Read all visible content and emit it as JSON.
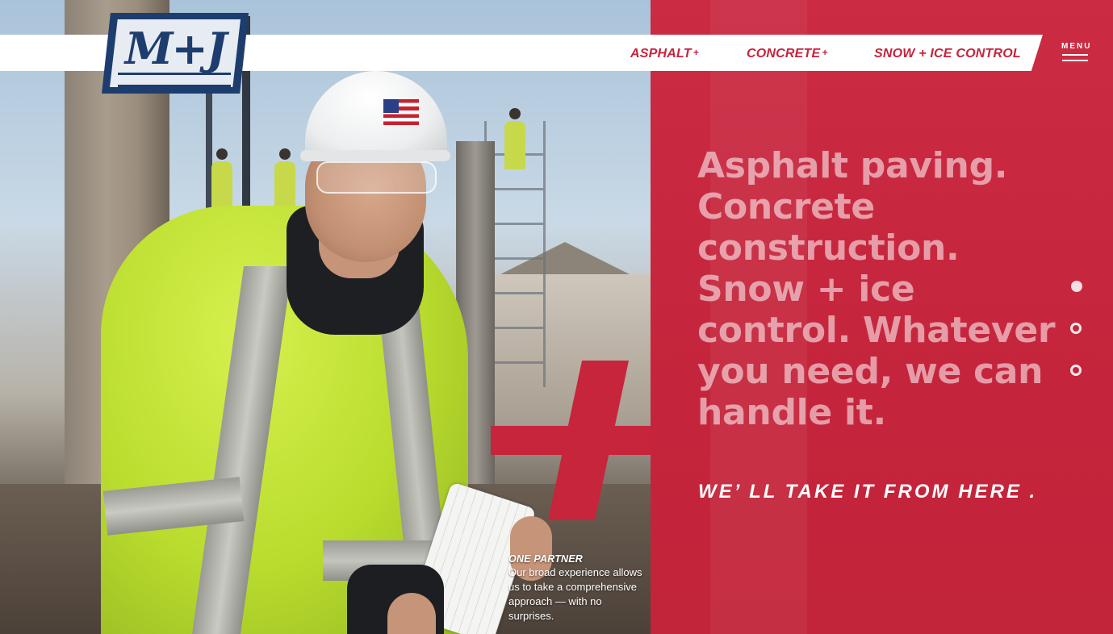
{
  "brand": {
    "logo_text": "M+J",
    "colors": {
      "primary_red": "#c8233b",
      "navy": "#1d3d6f",
      "white": "#ffffff"
    }
  },
  "nav": {
    "items": [
      {
        "label": "ASPHALT",
        "suffix": "+"
      },
      {
        "label": "CONCRETE",
        "suffix": "+"
      },
      {
        "label": "SNOW + ICE CONTROL",
        "suffix": ""
      }
    ],
    "menu_label": "MENU"
  },
  "hero": {
    "headline": "Asphalt paving. Concrete construction. Snow + ice control. Whatever you need, we can handle it.",
    "tagline": "WE’ LL TAKE IT FROM HERE ."
  },
  "caption": {
    "title": "ONE PARTNER",
    "body": "Our broad experience allows us to take a comprehensive approach — with no surprises."
  },
  "slider": {
    "count": 3,
    "active_index": 0
  }
}
